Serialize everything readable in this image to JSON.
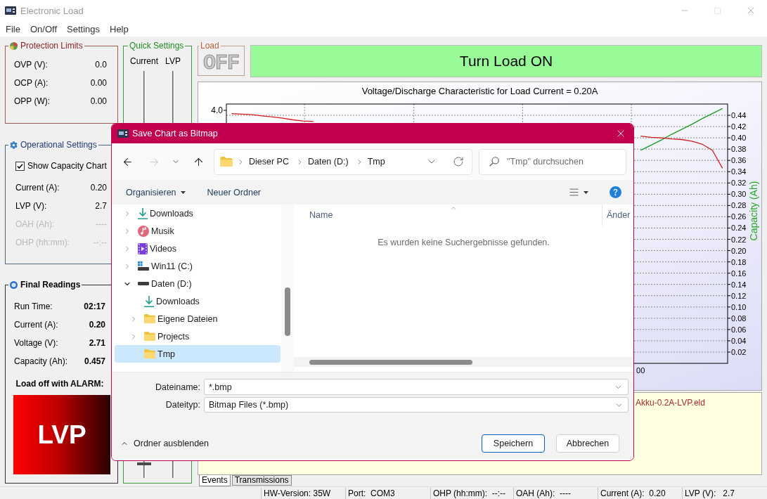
{
  "window": {
    "title": "Electronic Load"
  },
  "menu": [
    "File",
    "On/Off",
    "Settings",
    "Help"
  ],
  "protection_limits": {
    "title": "Protection Limits",
    "rows": [
      {
        "label": "OVP (V):",
        "value": "0.0"
      },
      {
        "label": "OCP (A):",
        "value": "0.00"
      },
      {
        "label": "OPP (W):",
        "value": "0.00"
      }
    ]
  },
  "quick_settings": {
    "title": "Quick Settings",
    "sliders": [
      {
        "label": "Current",
        "level": 0.035
      },
      {
        "label": "LVP"
      }
    ]
  },
  "operational_settings": {
    "title": "Operational Settings",
    "show_capacity_chart": {
      "label": "Show Capacity Chart",
      "checked": true
    },
    "rows": [
      {
        "label": "Current (A):",
        "value": "0.20",
        "disabled": false
      },
      {
        "label": "LVP (V):",
        "value": "2.7",
        "disabled": false
      },
      {
        "label": "OAH (Ah):",
        "value": "----",
        "disabled": true
      },
      {
        "label": "OHP (hh:mm):",
        "value": "--:--",
        "disabled": true
      }
    ]
  },
  "final_readings": {
    "title": "Final Readings",
    "rows": [
      {
        "label": "Run Time:",
        "value": "02:17"
      },
      {
        "label": "Current (A):",
        "value": "0.20"
      },
      {
        "label": "Voltage (V):",
        "value": "2.71"
      },
      {
        "label": "Capacity (Ah):",
        "value": "0.457"
      }
    ],
    "alarm": {
      "label": "Load off with ALARM:",
      "code": "LVP",
      "active": true
    }
  },
  "load": {
    "title": "Load",
    "on": false,
    "display": "OFF",
    "button": "Turn Load ON"
  },
  "chart": {
    "chart_data": {
      "type": "line",
      "title": "Voltage/Discharge Characteristic for Load Current = 0.20A",
      "ylabel": "Capacity (Ah)",
      "ylim": [
        0,
        0.46
      ],
      "yticks": [
        0.02,
        0.04,
        0.06,
        0.08,
        {
          "value": 0.1,
          "label": "0.10"
        },
        0.12,
        0.14,
        0.16,
        0.18,
        {
          "value": 0.2,
          "label": "0.20"
        },
        0.22,
        0.24,
        0.26,
        0.28,
        {
          "value": 0.3,
          "label": "0.30"
        },
        0.32,
        0.34,
        0.36,
        0.38,
        {
          "value": 0.4,
          "label": "0.40"
        },
        0.42,
        0.44
      ],
      "grid": true,
      "series": [
        {
          "color": "#1e9a1e",
          "values": [
            null,
            null,
            null,
            null,
            null,
            null,
            null,
            null,
            null,
            null,
            null,
            null,
            null,
            null,
            null,
            null,
            null,
            null,
            null,
            null,
            null,
            null,
            null,
            null,
            null,
            null,
            null,
            null,
            null,
            null,
            null,
            null,
            null,
            null,
            null,
            null,
            null,
            null,
            null,
            null,
            0.378,
            0.387,
            0.396,
            0.406,
            0.415,
            0.424,
            0.434,
            0.443,
            0.452
          ]
        },
        {
          "color": "#d41c1c",
          "values": [
            0.443,
            0.442,
            0.441,
            0.439,
            0.437,
            0.435,
            0.432,
            0.43,
            0.429,
            null,
            null,
            null,
            null,
            null,
            null,
            null,
            null,
            null,
            null,
            null,
            null,
            null,
            null,
            null,
            null,
            null,
            null,
            null,
            null,
            null,
            null,
            null,
            null,
            null,
            null,
            null,
            null,
            null,
            null,
            null,
            0.403,
            0.401,
            0.4,
            0.398,
            0.397,
            0.394,
            0.389,
            0.378,
            0.346
          ]
        }
      ],
      "annotations": [
        "00",
        "4.0"
      ]
    }
  },
  "log": {
    "lines": [
      "Akku-0.2A-LVP.eld"
    ],
    "tabs": [
      {
        "label": "Events",
        "selected": true
      },
      {
        "label": "Transmissions",
        "selected": false
      }
    ]
  },
  "status_bar": [
    "HW-Version: 35W",
    "Port:  COM3",
    "OHP (hh:mm):  --:--",
    "OAH (Ah):  ----",
    "Current (A):  0.20",
    "LVP (V):   2.7"
  ],
  "dialog": {
    "title": "Save Chart as Bitmap",
    "nav_buttons": [
      {
        "kind": "back",
        "disabled": false
      },
      {
        "kind": "forward",
        "disabled": true
      },
      {
        "kind": "recent",
        "disabled": false
      },
      {
        "kind": "up",
        "disabled": false
      }
    ],
    "breadcrumb": [
      "Dieser PC",
      "Daten (D:)",
      "Tmp"
    ],
    "search": {
      "placeholder": "\"Tmp\" durchsuchen"
    },
    "toolbar": {
      "organize": "Organisieren",
      "new_folder": "Neuer Ordner"
    },
    "tree": [
      {
        "label": "Downloads",
        "kind": "download",
        "expandable": true,
        "expanded": false,
        "selected": false
      },
      {
        "label": "Musik",
        "kind": "music",
        "expandable": true,
        "expanded": false,
        "selected": false
      },
      {
        "label": "Videos",
        "kind": "video",
        "expandable": true,
        "expanded": false,
        "selected": false
      },
      {
        "label": "Win11 (C:)",
        "kind": "system-drive",
        "expandable": true,
        "expanded": false,
        "selected": false
      },
      {
        "label": "Daten (D:)",
        "kind": "drive",
        "expandable": true,
        "expanded": true,
        "selected": false,
        "children": [
          {
            "label": "Downloads",
            "kind": "download",
            "expandable": false,
            "selected": false
          },
          {
            "label": "Eigene Dateien",
            "kind": "folder",
            "expandable": true,
            "expanded": false,
            "selected": false
          },
          {
            "label": "Projects",
            "kind": "folder",
            "expandable": true,
            "expanded": false,
            "selected": false
          },
          {
            "label": "Tmp",
            "kind": "folder",
            "expandable": false,
            "selected": true
          }
        ]
      }
    ],
    "columns": [
      "Name",
      "Änder"
    ],
    "empty_message": "Es wurden keine Suchergebnisse gefunden.",
    "file_name": {
      "label": "Dateiname:",
      "value": "*.bmp"
    },
    "file_type": {
      "label": "Dateityp:",
      "value": "Bitmap Files (*.bmp)"
    },
    "hide_folders": "Ordner ausblenden",
    "buttons": [
      {
        "label": "Speichern",
        "primary": true
      },
      {
        "label": "Abbrechen",
        "primary": false
      }
    ]
  }
}
